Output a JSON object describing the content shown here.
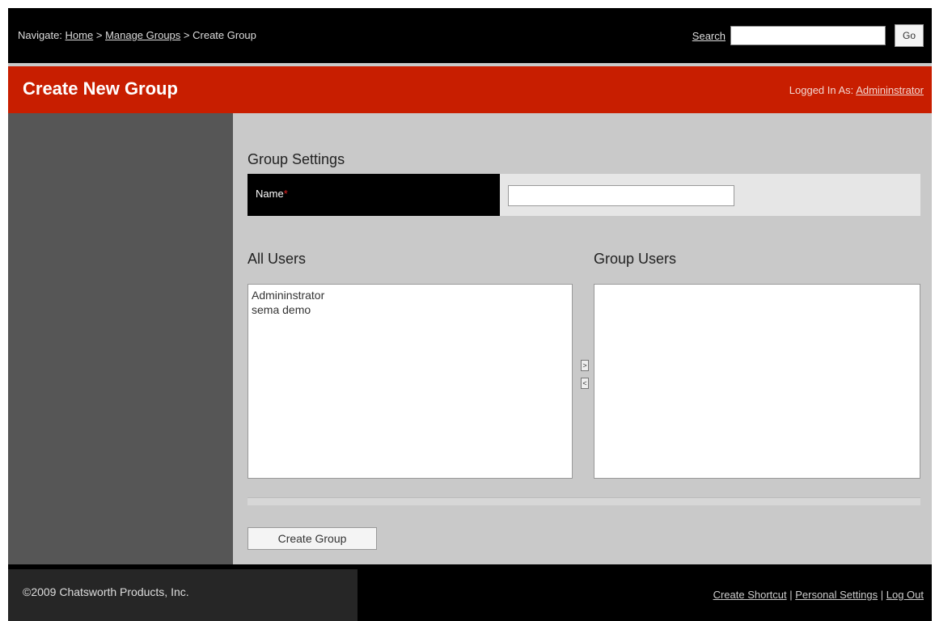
{
  "nav": {
    "prefix": "Navigate: ",
    "crumbs": [
      "Home",
      "Manage Groups",
      "Create Group"
    ],
    "separator": " > ",
    "search_label": "Search",
    "go_label": "Go"
  },
  "header": {
    "title": "Create New Group",
    "logged_prefix": "Logged In As: ",
    "user": "Admininstrator"
  },
  "main": {
    "settings_title": "Group Settings",
    "name_label": "Name",
    "required_mark": "*",
    "name_value": "",
    "all_users_title": "All Users",
    "group_users_title": "Group Users",
    "all_users": [
      "Admininstrator",
      "sema demo"
    ],
    "group_users": [],
    "add_arrow": ">",
    "remove_arrow": "<",
    "create_button": "Create Group"
  },
  "footer": {
    "copyright": "©2009 Chatsworth Products, Inc.",
    "links": [
      "Create Shortcut",
      "Personal Settings",
      "Log Out"
    ],
    "link_separator": " | "
  },
  "colors": {
    "header_red": "#c81e00",
    "topbar": "#000000",
    "sidebar": "#565656",
    "content_bg": "#c9c9c9"
  }
}
